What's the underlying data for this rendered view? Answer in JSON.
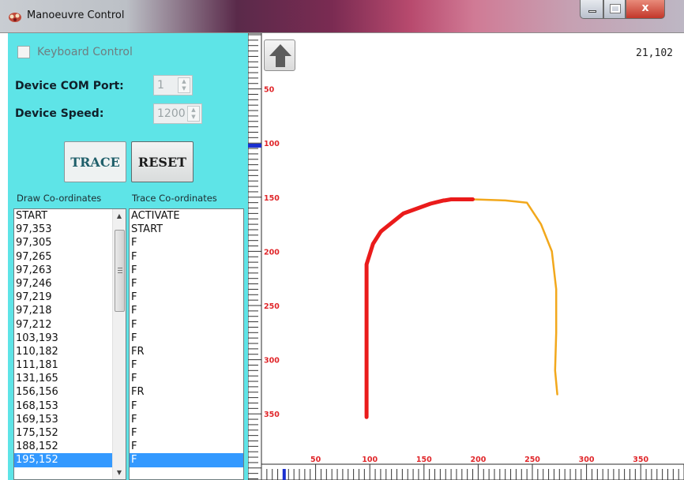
{
  "window": {
    "title": "Manoeuvre Control",
    "close_glyph": "x"
  },
  "controls": {
    "keyboard_control_label": "Keyboard Control",
    "keyboard_control_checked": false,
    "com_port_label": "Device COM Port:",
    "com_port_value": "1",
    "speed_label": "Device Speed:",
    "speed_value": "1200",
    "trace_button": "TRACE",
    "reset_button": "RESET"
  },
  "lists": {
    "draw_header": "Draw Co-ordinates",
    "trace_header": "Trace Co-ordinates",
    "draw_items": [
      "START",
      "97,353",
      "97,305",
      "97,265",
      "97,263",
      "97,246",
      "97,219",
      "97,218",
      "97,212",
      "103,193",
      "110,182",
      "111,181",
      "131,165",
      "156,156",
      "168,153",
      "169,153",
      "175,152",
      "188,152",
      "195,152"
    ],
    "trace_items": [
      "ACTIVATE",
      "START",
      "F",
      "F",
      "F",
      "F",
      "F",
      "F",
      "F",
      "F",
      "FR",
      "F",
      "F",
      "FR",
      "F",
      "F",
      "F",
      "F",
      "F"
    ],
    "selected_index": 18
  },
  "canvas": {
    "coord_readout": "21,102",
    "y_ticks": [
      "50",
      "100",
      "150",
      "200",
      "250",
      "300",
      "350"
    ],
    "x_ticks": [
      "50",
      "100",
      "150",
      "200",
      "250",
      "300",
      "350"
    ],
    "drawn_path_color": "#ea1b1b",
    "traced_path_color": "#f2a81c",
    "drawn_path": [
      [
        97,
        353
      ],
      [
        97,
        305
      ],
      [
        97,
        265
      ],
      [
        97,
        263
      ],
      [
        97,
        246
      ],
      [
        97,
        219
      ],
      [
        97,
        218
      ],
      [
        97,
        212
      ],
      [
        103,
        193
      ],
      [
        110,
        182
      ],
      [
        111,
        181
      ],
      [
        131,
        165
      ],
      [
        156,
        156
      ],
      [
        168,
        153
      ],
      [
        169,
        153
      ],
      [
        175,
        152
      ],
      [
        188,
        152
      ],
      [
        195,
        152
      ]
    ],
    "traced_path": [
      [
        195,
        152
      ],
      [
        225,
        153
      ],
      [
        245,
        155
      ],
      [
        258,
        175
      ],
      [
        268,
        200
      ],
      [
        272,
        235
      ],
      [
        272,
        275
      ],
      [
        271,
        310
      ],
      [
        273,
        332
      ]
    ]
  },
  "icons": {
    "app_icon": "app-logo-icon",
    "up_arrow": "up-arrow-icon"
  }
}
